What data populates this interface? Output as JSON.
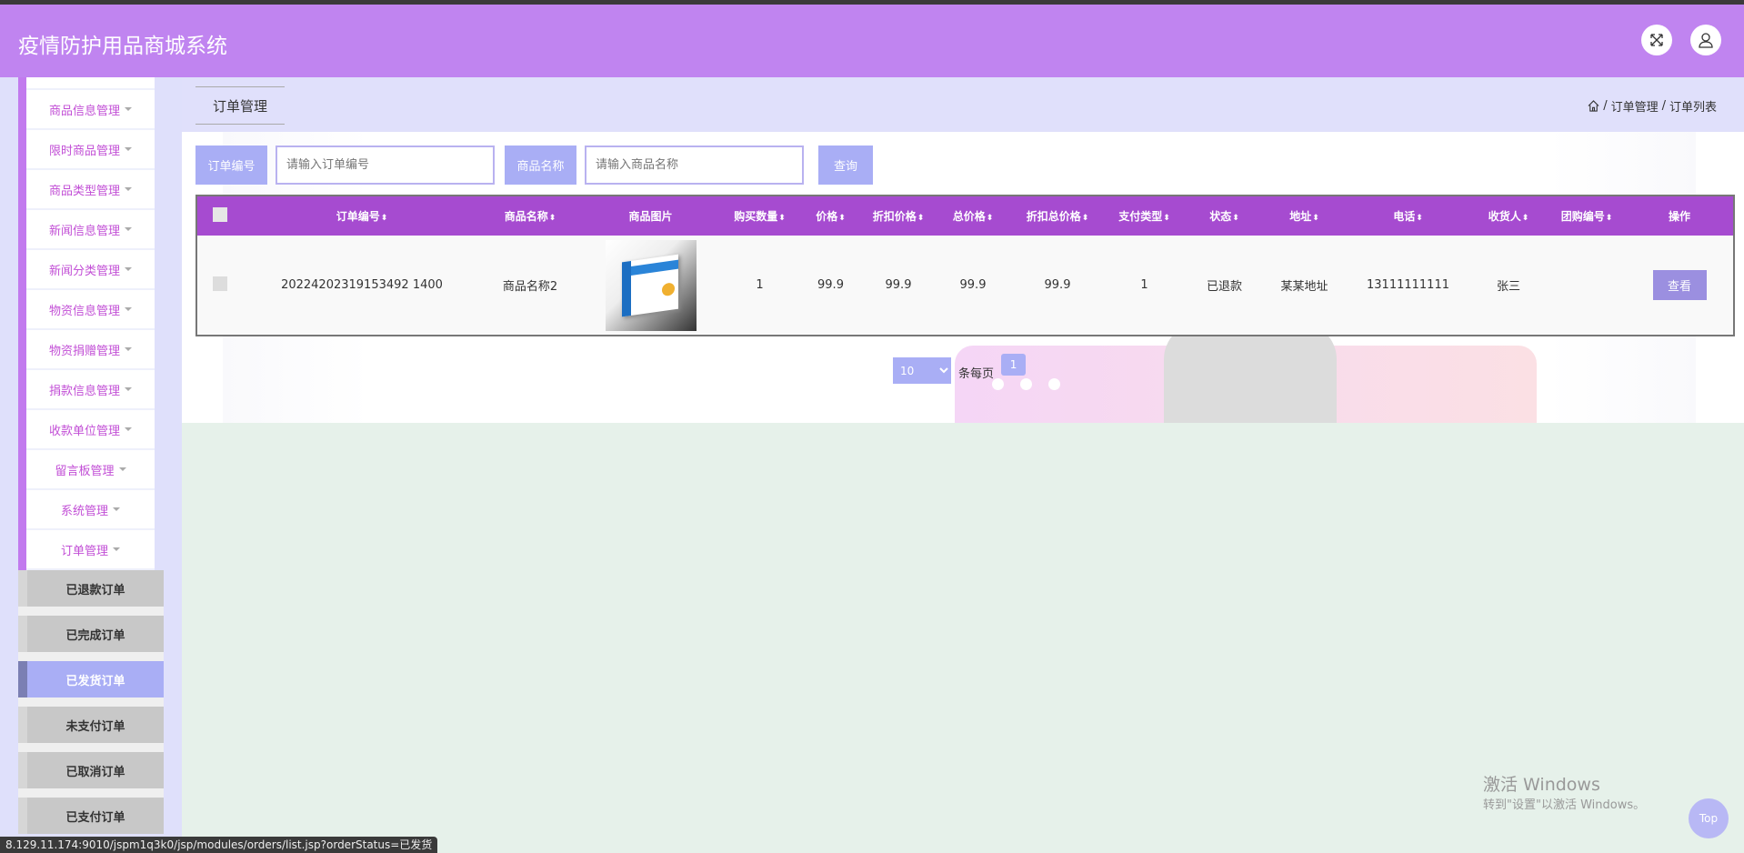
{
  "header": {
    "title": "疫情防护用品商城系统",
    "fullscreen_icon": "expand-icon",
    "user_icon": "user-icon"
  },
  "sidebar": {
    "items": [
      {
        "label": "商品信息管理"
      },
      {
        "label": "限时商品管理"
      },
      {
        "label": "商品类型管理"
      },
      {
        "label": "新闻信息管理"
      },
      {
        "label": "新闻分类管理"
      },
      {
        "label": "物资信息管理"
      },
      {
        "label": "物资捐赠管理"
      },
      {
        "label": "捐款信息管理"
      },
      {
        "label": "收款单位管理"
      },
      {
        "label": "留言板管理"
      },
      {
        "label": "系统管理"
      },
      {
        "label": "订单管理"
      }
    ],
    "submenu": [
      {
        "label": "已退款订单",
        "active": false
      },
      {
        "label": "已完成订单",
        "active": false
      },
      {
        "label": "已发货订单",
        "active": true
      },
      {
        "label": "未支付订单",
        "active": false
      },
      {
        "label": "已取消订单",
        "active": false
      },
      {
        "label": "已支付订单",
        "active": false
      }
    ]
  },
  "main": {
    "tab": "订单管理",
    "breadcrumb": [
      "订单管理",
      "订单列表"
    ],
    "breadcrumb_sep": "/",
    "search": {
      "order_no_label": "订单编号",
      "order_no_placeholder": "请输入订单编号",
      "order_no_value": "",
      "product_label": "商品名称",
      "product_placeholder": "请输入商品名称",
      "product_value": "",
      "query_button": "查询"
    },
    "table": {
      "columns": [
        "订单编号",
        "商品名称",
        "商品图片",
        "购买数量",
        "价格",
        "折扣价格",
        "总价格",
        "折扣总价格",
        "支付类型",
        "状态",
        "地址",
        "电话",
        "收货人",
        "团购编号",
        "操作"
      ],
      "sortable": [
        true,
        true,
        false,
        true,
        true,
        true,
        true,
        true,
        true,
        true,
        true,
        true,
        true,
        true,
        false
      ],
      "sort_glyph": "⬍",
      "rows": [
        {
          "order_no": "20224202319153492 1400",
          "product": "商品名称2",
          "qty": "1",
          "price": "99.9",
          "discount_price": "99.9",
          "total": "99.9",
          "discount_total": "99.9",
          "pay_type": "1",
          "status": "已退款",
          "address": "某某地址",
          "phone": "13111111111",
          "receiver": "张三",
          "group_no": "",
          "action": "查看"
        }
      ]
    },
    "pagination": {
      "page_size": "10",
      "per_page_label": "条每页",
      "current_page": "1"
    }
  },
  "status_url": "8.129.11.174:9010/jspm1q3k0/jsp/modules/orders/list.jsp?orderStatus=已发货",
  "watermark": {
    "line1": "激活 Windows",
    "line2": "转到\"设置\"以激活 Windows。"
  },
  "top_button": "Top",
  "colors": {
    "header": "#c084f0",
    "table_header": "#a64bd0",
    "accent": "#a9aef5",
    "view_button": "#9b8fe0"
  }
}
